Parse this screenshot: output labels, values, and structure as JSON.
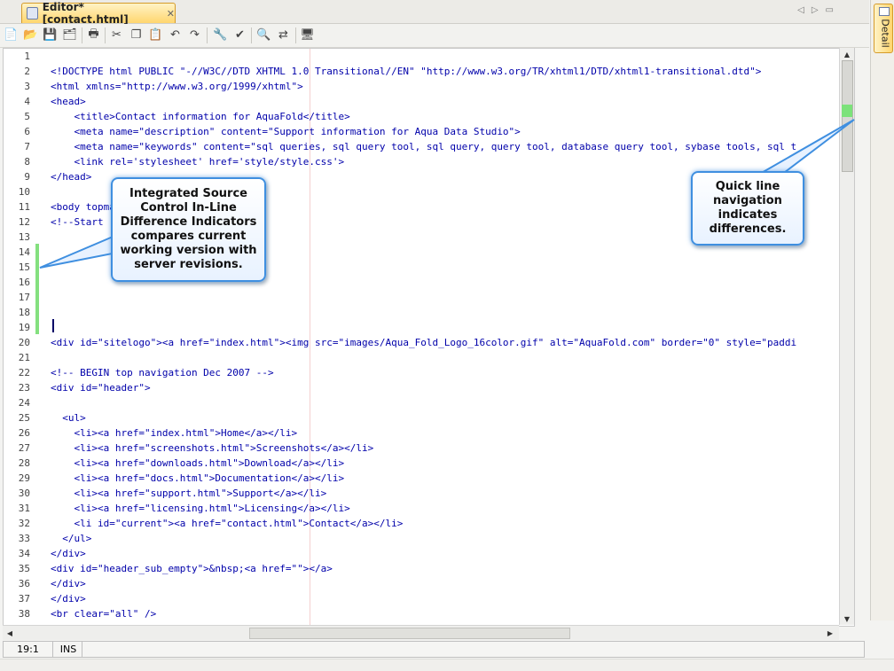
{
  "tab": {
    "title": "Editor* [contact.html]",
    "close": "✕"
  },
  "tab_nav": [
    "◁",
    "▷",
    "▭"
  ],
  "toolbar": [
    "new-file-icon",
    "open-folder-icon",
    "save-icon",
    "save-all-icon",
    "print-icon",
    "cut-icon",
    "copy-icon",
    "paste-icon",
    "undo-icon",
    "redo-icon",
    "wrench-icon",
    "validate-icon",
    "find-icon",
    "replace-icon",
    "preview-icon"
  ],
  "editor": {
    "lines": [
      {
        "n": "1",
        "t": ""
      },
      {
        "n": "2",
        "t": "<!DOCTYPE html PUBLIC \"-//W3C//DTD XHTML 1.0 Transitional//EN\" \"http://www.w3.org/TR/xhtml1/DTD/xhtml1-transitional.dtd\">"
      },
      {
        "n": "3",
        "t": "<html xmlns=\"http://www.w3.org/1999/xhtml\">"
      },
      {
        "n": "4",
        "t": "<head>"
      },
      {
        "n": "5",
        "t": "    <title>Contact information for AquaFold</title>"
      },
      {
        "n": "6",
        "t": "    <meta name=\"description\" content=\"Support information for Aqua Data Studio\">"
      },
      {
        "n": "7",
        "t": "    <meta name=\"keywords\" content=\"sql queries, sql query tool, sql query, query tool, database query tool, sybase tools, sql t"
      },
      {
        "n": "8",
        "t": "    <link rel='stylesheet' href='style/style.css'>"
      },
      {
        "n": "9",
        "t": "</head>"
      },
      {
        "n": "10",
        "t": ""
      },
      {
        "n": "11",
        "t": "<body topmar"
      },
      {
        "n": "12",
        "t": "<!--Start"
      },
      {
        "n": "13",
        "t": ""
      },
      {
        "n": "14",
        "t": ""
      },
      {
        "n": "15",
        "t": ""
      },
      {
        "n": "16",
        "t": ""
      },
      {
        "n": "17",
        "t": ""
      },
      {
        "n": "18",
        "t": ""
      },
      {
        "n": "19",
        "t": ""
      },
      {
        "n": "20",
        "t": "<div id=\"sitelogo\"><a href=\"index.html\"><img src=\"images/Aqua_Fold_Logo_16color.gif\" alt=\"AquaFold.com\" border=\"0\" style=\"paddi"
      },
      {
        "n": "21",
        "t": ""
      },
      {
        "n": "22",
        "t": "<!-- BEGIN top navigation Dec 2007 -->"
      },
      {
        "n": "23",
        "t": "<div id=\"header\">"
      },
      {
        "n": "24",
        "t": ""
      },
      {
        "n": "25",
        "t": "  <ul>"
      },
      {
        "n": "26",
        "t": "    <li><a href=\"index.html\">Home</a></li>"
      },
      {
        "n": "27",
        "t": "    <li><a href=\"screenshots.html\">Screenshots</a></li>"
      },
      {
        "n": "28",
        "t": "    <li><a href=\"downloads.html\">Download</a></li>"
      },
      {
        "n": "29",
        "t": "    <li><a href=\"docs.html\">Documentation</a></li>"
      },
      {
        "n": "30",
        "t": "    <li><a href=\"support.html\">Support</a></li>"
      },
      {
        "n": "31",
        "t": "    <li><a href=\"licensing.html\">Licensing</a></li>"
      },
      {
        "n": "32",
        "t": "    <li id=\"current\"><a href=\"contact.html\">Contact</a></li>"
      },
      {
        "n": "33",
        "t": "  </ul>"
      },
      {
        "n": "34",
        "t": "</div>"
      },
      {
        "n": "35",
        "t": "<div id=\"header_sub_empty\">&nbsp;<a href=\"\"></a>"
      },
      {
        "n": "36",
        "t": "</div>"
      },
      {
        "n": "37",
        "t": "</div>"
      },
      {
        "n": "38",
        "t": "<br clear=\"all\" />"
      }
    ],
    "current_line": "19"
  },
  "status": {
    "position": "19:1",
    "mode": "INS"
  },
  "detail_panel": {
    "label": "Detail"
  },
  "callouts": {
    "left": "Integrated Source Control In-Line Difference Indicators compares current working version with server revisions.",
    "right": "Quick line navigation indicates differences."
  },
  "colors": {
    "accent": "#ffd66e",
    "diff_marker": "#84e07f",
    "callout_border": "#3f8fe0",
    "current_line": "#fbfbc8"
  }
}
